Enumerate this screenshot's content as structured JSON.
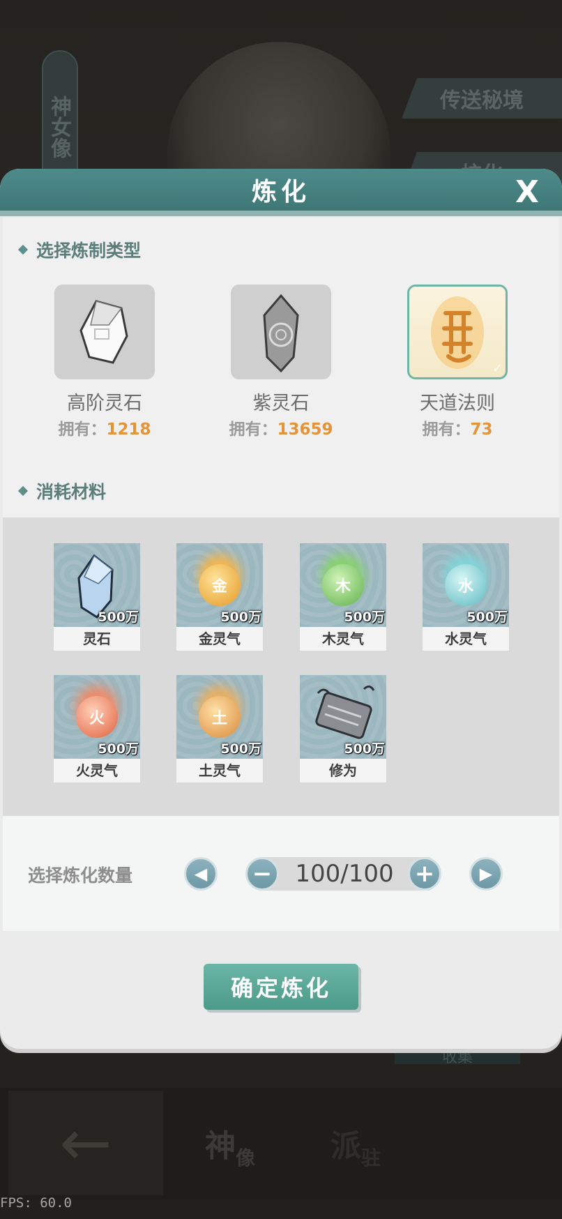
{
  "background": {
    "statue_label": "神女像",
    "side_buttons": [
      "传送秘境",
      "校化",
      "收集"
    ],
    "nav_tabs": [
      {
        "main": "神",
        "sub": "像"
      },
      {
        "main": "派",
        "sub": "驻"
      }
    ],
    "back_icon": "arrow-left-icon"
  },
  "fps": "FPS: 60.0",
  "modal": {
    "title": "炼化",
    "close_label": "X",
    "type_section": {
      "title": "选择炼制类型",
      "own_prefix": "拥有：",
      "types": [
        {
          "name": "高阶灵石",
          "count": "1218",
          "icon": "white-stone-icon",
          "selected": false
        },
        {
          "name": "紫灵石",
          "count": "13659",
          "icon": "purple-stone-icon",
          "selected": false
        },
        {
          "name": "天道法则",
          "count": "73",
          "icon": "golden-rune-icon",
          "selected": true
        }
      ]
    },
    "materials_section": {
      "title": "消耗材料",
      "items": [
        {
          "label": "灵石",
          "amount": "500万",
          "icon": "blue-crystal-icon",
          "glyph": ""
        },
        {
          "label": "金灵气",
          "amount": "500万",
          "icon": "metal-flame-icon",
          "glyph": "金"
        },
        {
          "label": "木灵气",
          "amount": "500万",
          "icon": "wood-flame-icon",
          "glyph": "木"
        },
        {
          "label": "水灵气",
          "amount": "500万",
          "icon": "water-flame-icon",
          "glyph": "水"
        },
        {
          "label": "火灵气",
          "amount": "500万",
          "icon": "fire-flame-icon",
          "glyph": "火"
        },
        {
          "label": "土灵气",
          "amount": "500万",
          "icon": "earth-flame-icon",
          "glyph": "土"
        },
        {
          "label": "修为",
          "amount": "500万",
          "icon": "scroll-icon",
          "glyph": ""
        }
      ]
    },
    "quantity": {
      "label": "选择炼化数量",
      "value": "100/100"
    },
    "confirm_label": "确定炼化"
  },
  "colors": {
    "header": "#4d8b8a",
    "accent_number": "#e2943b",
    "confirm": "#5ba898"
  }
}
